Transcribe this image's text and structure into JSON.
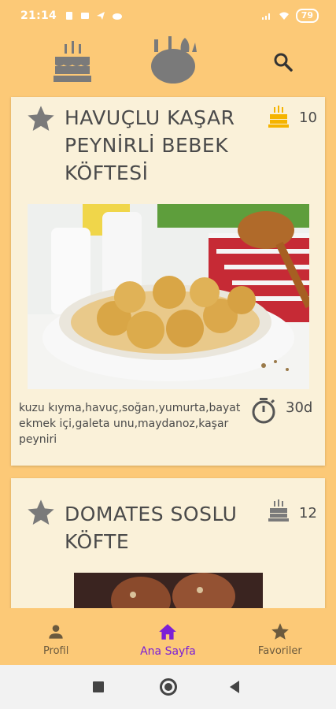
{
  "status_bar": {
    "time": "21:14",
    "battery": "79",
    "left_icons": [
      "sim-icon",
      "gallery-icon",
      "telegram-icon",
      "cloud-icon"
    ],
    "right_icons": [
      "signal-icon",
      "wifi-icon",
      "battery-icon"
    ]
  },
  "app_bar": {
    "icons": [
      "birthday-cake-icon",
      "dishes-icon",
      "search-icon"
    ]
  },
  "recipes": [
    {
      "title_lines": [
        "HAVUÇLU KAŞAR",
        "PEYNİRLİ BEBEK",
        "KÖFTESİ"
      ],
      "portion": "10",
      "ingredients": "kuzu kıyma,havuç,soğan,yumurta,bayat ekmek içi,galeta unu,maydanoz,kaşar peyniri",
      "time": "30d",
      "favorite_icon": "star-icon",
      "portion_icon": "cake-icon",
      "time_icon": "stopwatch-icon"
    },
    {
      "title_lines": [
        "DOMATES SOSLU",
        "KÖFTE"
      ],
      "portion": "12",
      "favorite_icon": "star-icon",
      "portion_icon": "cake-icon"
    }
  ],
  "bottom_nav": {
    "items": [
      {
        "label": "Profil",
        "icon": "person-icon",
        "active": false
      },
      {
        "label": "Ana Sayfa",
        "icon": "home-icon",
        "active": true
      },
      {
        "label": "Favoriler",
        "icon": "star-icon",
        "active": false
      }
    ]
  },
  "colors": {
    "background": "#fcc977",
    "card": "#faf1d9",
    "text": "#4a4a4a",
    "icon_gray": "#7a7a7a",
    "active_nav": "#7b1fd6",
    "cake_gold": "#f5b400"
  }
}
